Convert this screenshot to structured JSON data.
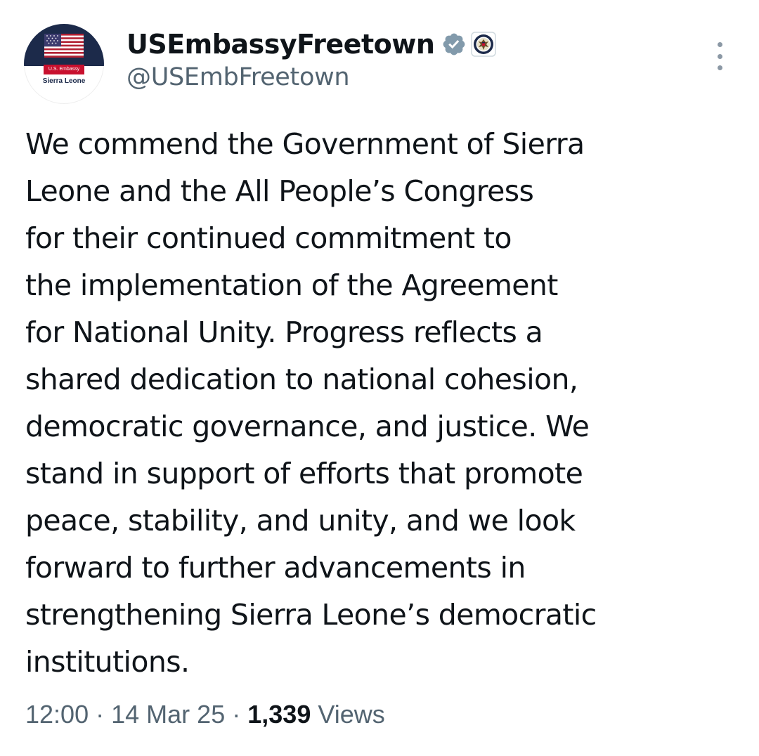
{
  "author": {
    "display_name": "USEmbassyFreetown",
    "handle": "@USEmbFreetown",
    "avatar_banner": "U.S. Embassy",
    "avatar_subtitle": "Sierra Leone",
    "verified_icon": "verified-badge-icon",
    "affiliation_icon": "us-state-department-seal-icon"
  },
  "tweet": {
    "lines": [
      "We commend the Government of Sierra",
      "Leone and the All People’s Congress",
      "for their continued commitment to",
      "the implementation of the Agreement",
      "for National Unity. Progress reflects a",
      "shared dedication to national cohesion,",
      "democratic governance, and justice. We",
      "stand in support of efforts that promote",
      "peace, stability, and unity, and we look",
      "forward to further advancements in",
      "strengthening Sierra Leone’s democratic",
      "institutions."
    ]
  },
  "meta": {
    "time": "12:00",
    "separator": "·",
    "date": "14 Mar 25",
    "views_count": "1,339",
    "views_label": "Views"
  },
  "menu": {
    "icon": "more-options-icon"
  },
  "colors": {
    "text_primary": "#0f1419",
    "text_secondary": "#536471",
    "verified_badge": "#829aab",
    "avatar_navy": "#1c2a4a",
    "avatar_red": "#c8102e"
  }
}
